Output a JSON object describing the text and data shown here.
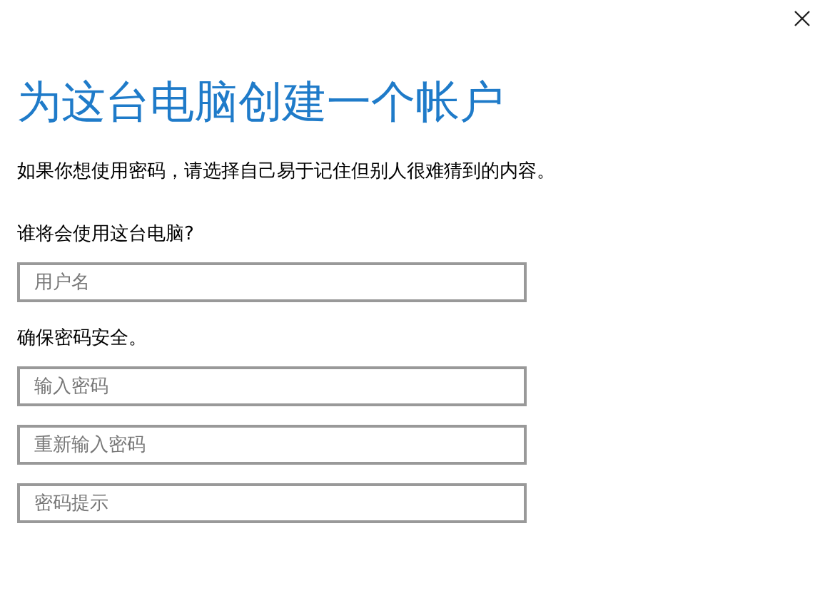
{
  "title": "为这台电脑创建一个帐户",
  "description": "如果你想使用密码，请选择自己易于记住但别人很难猜到的内容。",
  "sections": [
    {
      "label": "谁将会使用这台电脑?",
      "fields": [
        {
          "placeholder": "用户名"
        }
      ]
    },
    {
      "label": "确保密码安全。",
      "fields": [
        {
          "placeholder": "输入密码"
        },
        {
          "placeholder": "重新输入密码"
        },
        {
          "placeholder": "密码提示"
        }
      ]
    }
  ]
}
